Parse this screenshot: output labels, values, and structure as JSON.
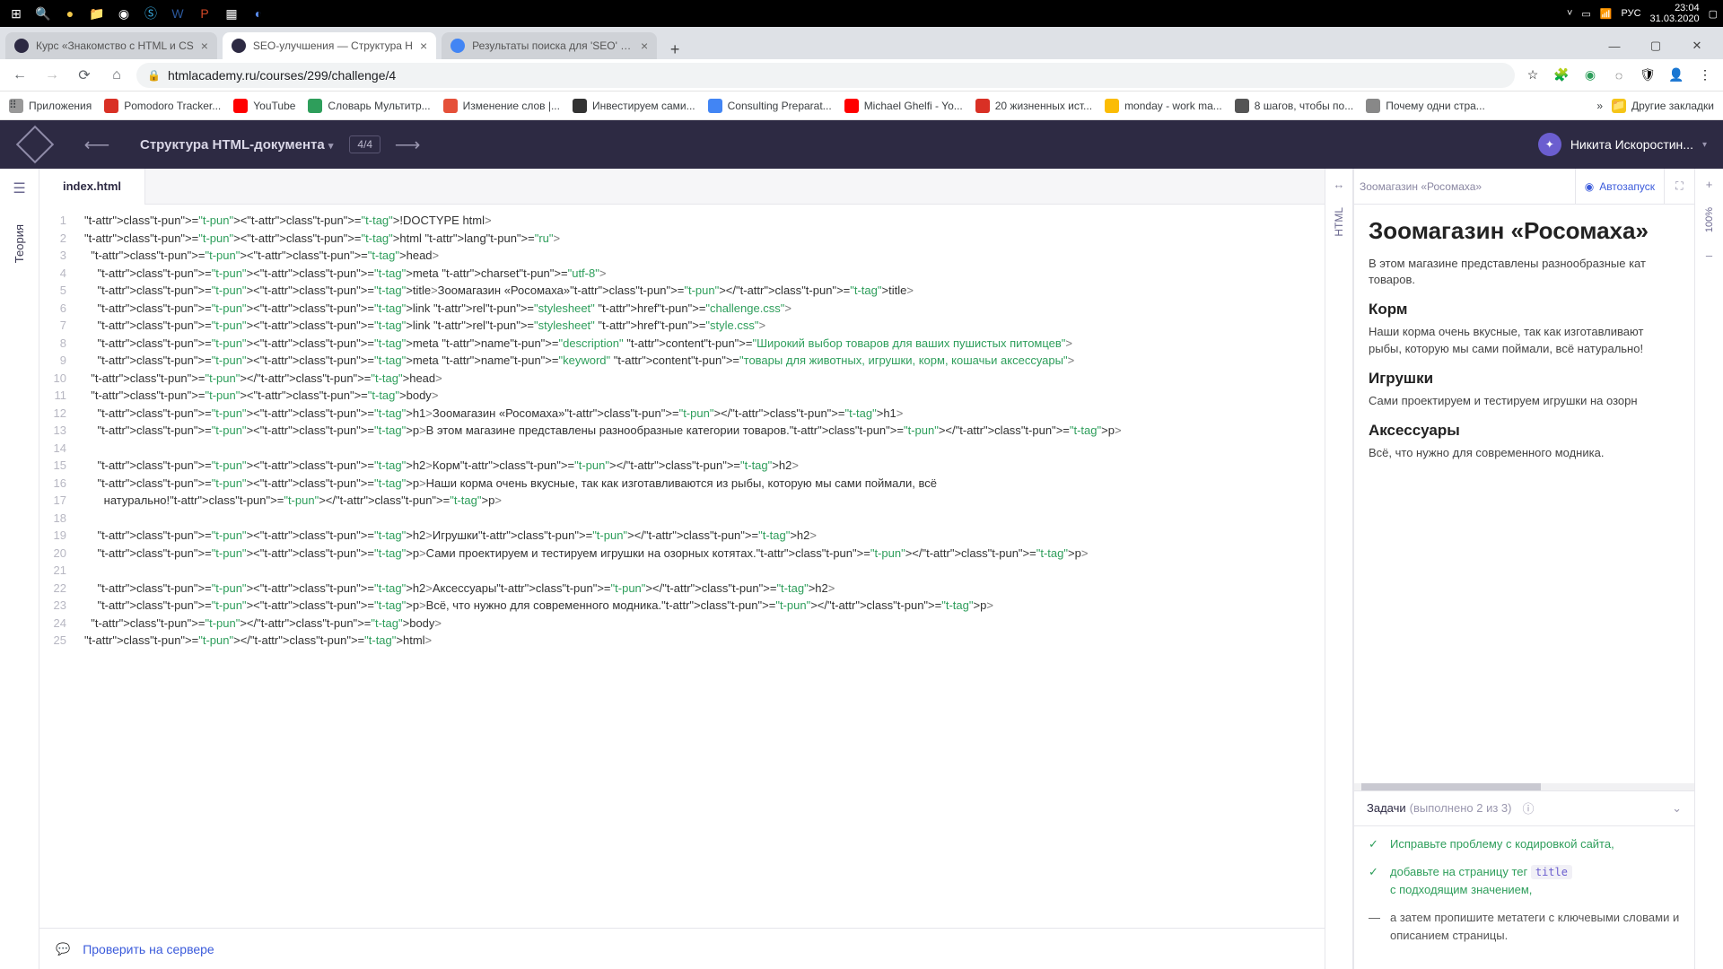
{
  "taskbar": {
    "time": "23:04",
    "date": "31.03.2020",
    "lang": "РУС"
  },
  "tabs": [
    {
      "title": "Курс «Знакомство с HTML и CS"
    },
    {
      "title": "SEO-улучшения — Структура H"
    },
    {
      "title": "Результаты поиска для 'SEO' - С"
    }
  ],
  "omnibox": {
    "url": "htmlacademy.ru/courses/299/challenge/4"
  },
  "bookmarks": {
    "apps": "Приложения",
    "items": [
      "Pomodoro Tracker...",
      "YouTube",
      "Словарь Мультитр...",
      "Изменение слов |...",
      "Инвестируем сами...",
      "Consulting Preparat...",
      "Michael Ghelfi - Yo...",
      "20 жизненных ист...",
      "monday - work ma...",
      "8 шагов, чтобы по...",
      "Почему одни стра..."
    ],
    "other": "Другие закладки"
  },
  "app": {
    "crumb": "Структура HTML-документа",
    "progress": "4/4",
    "user": "Никита Искоростин..."
  },
  "leftRail": {
    "theory": "Теория"
  },
  "editor": {
    "filename": "index.html",
    "lines": [
      "<!DOCTYPE html>",
      "<html lang=\"ru\">",
      "  <head>",
      "    <meta charset=\"utf-8\">",
      "    <title>Зоомагазин «Росомаха»</title>",
      "    <link rel=\"stylesheet\" href=\"challenge.css\">",
      "    <link rel=\"stylesheet\" href=\"style.css\">",
      "    <meta name=\"description\" content=\"Широкий выбор товаров для ваших пушистых питомцев\">",
      "    <meta name=\"keyword\" content=\"товары для животных, игрушки, корм, кошачьи аксессуары\">",
      "  </head>",
      "  <body>",
      "    <h1>Зоомагазин «Росомаха»</h1>",
      "    <p>В этом магазине представлены разнообразные категории товаров.</p>",
      "",
      "    <h2>Корм</h2>",
      "    <p>Наши корма очень вкусные, так как изготавливаются из рыбы, которую мы сами поймали, всё",
      "      натурально!</p>",
      "",
      "    <h2>Игрушки</h2>",
      "    <p>Сами проектируем и тестируем игрушки на озорных котятах.</p>",
      "",
      "    <h2>Аксессуары</h2>",
      "    <p>Всё, что нужно для современного модника.</p>",
      "  </body>",
      "</html>"
    ]
  },
  "footer": {
    "check": "Проверить на сервере"
  },
  "preview": {
    "tabTitle": "Зоомагазин «Росомаха»",
    "autorun": "Автозапуск",
    "h1": "Зоомагазин «Росомаха»",
    "p1": "В этом магазине представлены разнообразные кат\nтоваров.",
    "h2a": "Корм",
    "p2": "Наши корма очень вкусные, так как изготавливают\nрыбы, которую мы сами поймали, всё натурально!",
    "h2b": "Игрушки",
    "p3": "Сами проектируем и тестируем игрушки на озорн",
    "h2c": "Аксессуары",
    "p4": "Всё, что нужно для современного модника."
  },
  "rightRail": {
    "html": "HTML",
    "zoom": "100%",
    "plus": "+",
    "minus": "–"
  },
  "tasks": {
    "label": "Задачи",
    "count": "(выполнено 2 из 3)",
    "t1": "Исправьте проблему с кодировкой сайта,",
    "t2a": "добавьте на страницу тег ",
    "t2code": "title",
    "t2b": "с подходящим значением,",
    "t3": "а затем пропишите метатеги с ключевыми словами и описанием страницы."
  }
}
